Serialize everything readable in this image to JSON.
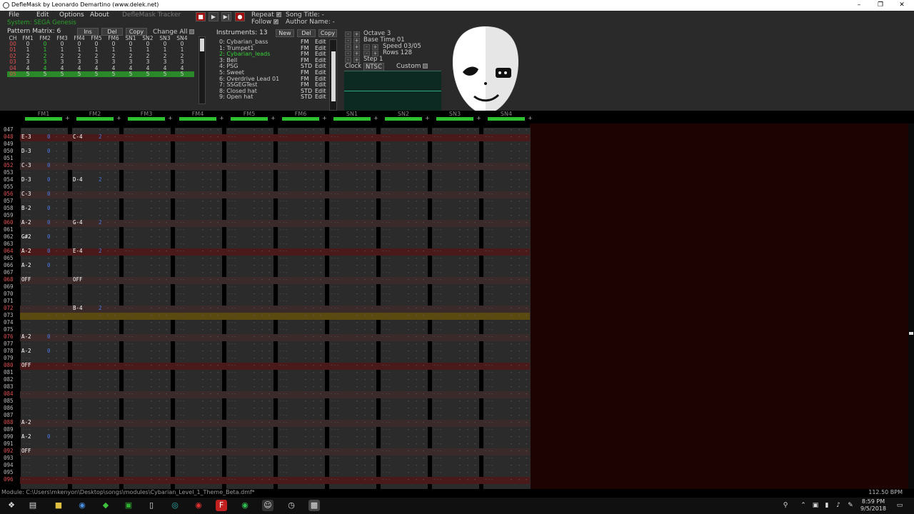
{
  "window": {
    "title": "DefleMask by Leonardo Demartino (www.delek.net)",
    "controls": [
      "–",
      "❐",
      "✕"
    ]
  },
  "menu": [
    "File",
    "Edit",
    "Options",
    "About"
  ],
  "tracker_label": "DefleMask Tracker",
  "transport": {
    "stop": "■",
    "play": "▶",
    "play_step": "▶|",
    "record": "●"
  },
  "options": {
    "repeat": "Repeat",
    "follow": "Follow",
    "song_title": "Song Title: -",
    "author_name": "Author Name: -"
  },
  "system": "System: SEGA Genesis",
  "pattern_matrix": {
    "label": "Pattern Matrix: 6",
    "buttons": [
      "Ins",
      "Del",
      "Copy"
    ],
    "change_all": "Change All",
    "headers": [
      "CH",
      "FM1",
      "FM2",
      "FM3",
      "FM4",
      "FM5",
      "FM6",
      "SN1",
      "SN2",
      "SN3",
      "SN4"
    ],
    "rows": [
      {
        "id": "00",
        "cells": [
          "0",
          "0",
          "0",
          "0",
          "0",
          "0",
          "0",
          "0",
          "0",
          "0"
        ]
      },
      {
        "id": "01",
        "cells": [
          "1",
          "1",
          "1",
          "1",
          "1",
          "1",
          "1",
          "1",
          "1",
          "1"
        ]
      },
      {
        "id": "02",
        "cells": [
          "2",
          "2",
          "2",
          "2",
          "2",
          "2",
          "2",
          "2",
          "2",
          "2"
        ]
      },
      {
        "id": "03",
        "cells": [
          "3",
          "3",
          "3",
          "3",
          "3",
          "3",
          "3",
          "3",
          "3",
          "3"
        ]
      },
      {
        "id": "04",
        "cells": [
          "4",
          "4",
          "4",
          "4",
          "4",
          "4",
          "4",
          "4",
          "4",
          "4"
        ]
      },
      {
        "id": "05",
        "cells": [
          "5",
          "5",
          "5",
          "5",
          "5",
          "5",
          "5",
          "5",
          "5",
          "5"
        ]
      }
    ]
  },
  "instruments": {
    "label": "Instruments: 13",
    "buttons": [
      "New",
      "Del",
      "Copy"
    ],
    "items": [
      {
        "name": "0: Cybarian_bass",
        "type": "FM",
        "edit": "Edit"
      },
      {
        "name": "1: Trumpet1",
        "type": "FM",
        "edit": "Edit"
      },
      {
        "name": "2: Cybarian_leads",
        "type": "FM",
        "edit": "Edit"
      },
      {
        "name": "3: Bell",
        "type": "FM",
        "edit": "Edit"
      },
      {
        "name": "4: PSG",
        "type": "STD",
        "edit": "Edit"
      },
      {
        "name": "5: Sweet",
        "type": "FM",
        "edit": "Edit"
      },
      {
        "name": "6: Overdrive Lead 01",
        "type": "FM",
        "edit": "Edit"
      },
      {
        "name": "7: SSGEGTest",
        "type": "FM",
        "edit": "Edit"
      },
      {
        "name": "8: Closed hat",
        "type": "STD",
        "edit": "Edit"
      },
      {
        "name": "9: Open hat",
        "type": "STD",
        "edit": "Edit"
      }
    ]
  },
  "song_props": {
    "octave": "Octave 3",
    "base_time": "Base Time 01",
    "speed": "Speed 03/05",
    "rows": "Rows 128",
    "step": "Step 1",
    "clock": "Clock",
    "ntsc": "NTSC",
    "custom": "Custom"
  },
  "channels": [
    "FM1",
    "FM2",
    "FM3",
    "FM4",
    "FM5",
    "FM6",
    "SN1",
    "SN2",
    "SN3",
    "SN4"
  ],
  "pattern": {
    "rows": [
      "047",
      "048",
      "049",
      "050",
      "051",
      "052",
      "053",
      "054",
      "055",
      "056",
      "057",
      "058",
      "059",
      "060",
      "061",
      "062",
      "063",
      "064",
      "065",
      "066",
      "067",
      "068",
      "069",
      "070",
      "071",
      "072",
      "073",
      "074",
      "075",
      "076",
      "077",
      "078",
      "079",
      "080",
      "081",
      "082",
      "083",
      "084",
      "085",
      "086",
      "087",
      "088",
      "089",
      "090",
      "091",
      "092",
      "093",
      "094",
      "095",
      "096"
    ],
    "fm1_notes": [
      "",
      "E-3",
      "",
      "D-3",
      "",
      "C-3",
      "",
      "D-3",
      "",
      "C-3",
      "",
      "B-2",
      "",
      "A-2",
      "",
      "G#2",
      "",
      "A-2",
      "",
      "A-2",
      "",
      "OFF",
      "",
      "",
      "",
      "",
      "",
      "",
      "",
      "A-2",
      "",
      "A-2",
      "",
      "OFF",
      "",
      "",
      "",
      "",
      "",
      "",
      "",
      "A-2",
      "",
      "A-2",
      "",
      "OFF",
      "",
      "",
      "",
      ""
    ],
    "fm1_insts": [
      "",
      "0",
      "",
      "0",
      "",
      "0",
      "",
      "0",
      "",
      "0",
      "",
      "0",
      "",
      "0",
      "",
      "0",
      "",
      "0",
      "",
      "0",
      "",
      "",
      "",
      "",
      "",
      "",
      "",
      "",
      "",
      "0",
      "",
      "0",
      "",
      "",
      "",
      "",
      "",
      "",
      "",
      "",
      "",
      "",
      "",
      "0",
      "",
      "",
      "",
      "",
      "",
      ""
    ],
    "fm2_notes": [
      "",
      "C-4",
      "",
      "",
      "",
      "",
      "",
      "D-4",
      "",
      "",
      "",
      "",
      "",
      "G-4",
      "",
      "",
      "",
      "E-4",
      "",
      "",
      "",
      "OFF",
      "",
      "",
      "",
      "B-4",
      "",
      "",
      "",
      "",
      "",
      "",
      "",
      "",
      "",
      "",
      "",
      "",
      "",
      "",
      "",
      "",
      "",
      "",
      "",
      "",
      "",
      "",
      "",
      ""
    ],
    "fm2_insts": [
      "",
      "2",
      "",
      "",
      "",
      "",
      "",
      "2",
      "",
      "",
      "",
      "",
      "",
      "2",
      "",
      "",
      "",
      "2",
      "",
      "",
      "",
      "",
      "",
      "",
      "",
      "2",
      "",
      "",
      "",
      "",
      "",
      "",
      "",
      "",
      "",
      "",
      "",
      "",
      "",
      "",
      "",
      "",
      "",
      "",
      "",
      "",
      "",
      "",
      "",
      ""
    ],
    "dash": "---",
    "sep": "-"
  },
  "status": {
    "module_path": "Module: C:\\Users\\mkenyon\\Desktop\\songs\\modules\\Cybarian_Level_1_Theme_Beta.dmf*",
    "bpm": "112.50 BPM"
  },
  "taskbar": {
    "time": "8:59 PM",
    "date": "9/5/2018"
  },
  "colors": {
    "accent_green": "#2fc02f",
    "note_red_row": "#e05050",
    "inst_blue": "#4a7ae0",
    "pattern_bg": "#1e0303"
  }
}
